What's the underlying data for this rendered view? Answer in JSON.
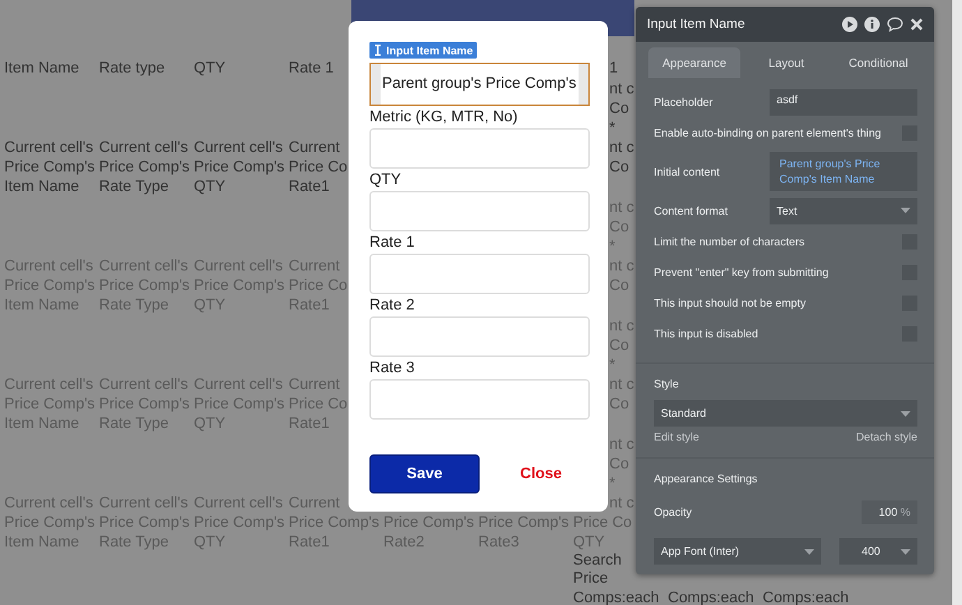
{
  "background": {
    "header": {
      "cells": [
        [
          "Item Name"
        ],
        [
          "Rate type"
        ],
        [
          "QTY"
        ],
        [
          "Rate 1"
        ],
        null,
        null,
        [
          "1"
        ]
      ]
    },
    "rows": [
      {
        "dim": false,
        "cells": [
          [
            "Current cell's",
            "Price Comp's",
            "Item Name"
          ],
          [
            "Current cell's",
            "Price Comp's",
            "Rate Type"
          ],
          [
            "Current cell's",
            "Price Comp's",
            "QTY"
          ],
          [
            "Current",
            "Price Co",
            "Rate1"
          ],
          null,
          null,
          [
            "nt c",
            "Co",
            "*",
            "nt c",
            "Co",
            null
          ]
        ]
      },
      {
        "dim": true,
        "cells": [
          [
            "Current cell's",
            "Price Comp's",
            "Item Name"
          ],
          [
            "Current cell's",
            "Price Comp's",
            "Rate Type"
          ],
          [
            "Current cell's",
            "Price Comp's",
            "QTY"
          ],
          [
            "Current",
            "Price Co",
            "Rate1"
          ],
          null,
          null,
          [
            "nt c",
            "Co",
            "*",
            "nt c",
            "Co",
            null
          ]
        ]
      },
      {
        "dim": true,
        "cells": [
          [
            "Current cell's",
            "Price Comp's",
            "Item Name"
          ],
          [
            "Current cell's",
            "Price Comp's",
            "Rate Type"
          ],
          [
            "Current cell's",
            "Price Comp's",
            "QTY"
          ],
          [
            "Current",
            "Price Co",
            "Rate1"
          ],
          null,
          null,
          [
            "nt c",
            "Co",
            "*",
            "nt c",
            "Co",
            null
          ]
        ]
      },
      {
        "dim": true,
        "cells": [
          [
            "Current cell's",
            "Price Comp's",
            "Item Name"
          ],
          [
            "Current cell's",
            "Price Comp's",
            "Rate Type"
          ],
          [
            "Current cell's",
            "Price Comp's",
            "QTY"
          ],
          [
            "Current",
            "Price Comp's",
            "Rate1"
          ],
          [
            null,
            "Price Comp's",
            "Rate2"
          ],
          [
            null,
            "Price Comp's",
            "Rate3"
          ],
          [
            "nt c",
            "Co",
            "*",
            "nt c",
            "Price Co",
            "QTY"
          ]
        ]
      },
      {
        "dim": false,
        "cells": [
          null,
          null,
          null,
          null,
          null,
          null,
          [
            "Search",
            "Price",
            "Comps:each"
          ],
          [
            null,
            "Comps:each"
          ],
          [
            null,
            "Comps:each"
          ]
        ]
      }
    ]
  },
  "modal": {
    "fields": [
      {
        "tag": "Input Item Name",
        "value": "Parent group's Price Comp's",
        "selected": true
      },
      {
        "label": "Metric (KG, MTR, No)",
        "selected": false
      },
      {
        "label": "QTY",
        "selected": false
      },
      {
        "label": "Rate 1",
        "selected": false
      },
      {
        "label": "Rate 2",
        "selected": false
      },
      {
        "label": "Rate 3",
        "selected": false
      }
    ],
    "save": "Save",
    "close": "Close"
  },
  "panel": {
    "title": "Input Item Name",
    "tabs": [
      {
        "label": "Appearance",
        "selected": true
      },
      {
        "label": "Layout",
        "selected": false
      },
      {
        "label": "Conditional",
        "selected": false
      }
    ],
    "rows": [
      {
        "kind": "field",
        "label": "Placeholder",
        "value": "asdf"
      },
      {
        "kind": "checkbox",
        "label": "Enable auto-binding on parent element's thing",
        "checked": false
      },
      {
        "kind": "expression",
        "label": "Initial content",
        "value": "Parent group's Price Comp's Item Name"
      },
      {
        "kind": "dropdown",
        "label": "Content format",
        "value": "Text"
      },
      {
        "kind": "checkbox",
        "label": "Limit the number of characters",
        "checked": false
      },
      {
        "kind": "checkbox",
        "label": "Prevent \"enter\" key from submitting",
        "checked": false
      },
      {
        "kind": "checkbox",
        "label": "This input should not be empty",
        "checked": false
      },
      {
        "kind": "checkbox",
        "label": "This input is disabled",
        "checked": false
      }
    ],
    "style": {
      "heading": "Style",
      "value": "Standard",
      "edit_link": "Edit style",
      "detach_link": "Detach style"
    },
    "appearance": {
      "heading": "Appearance Settings",
      "opacity_label": "Opacity",
      "opacity_value": "100",
      "opacity_unit": "%",
      "font": "App Font (Inter)",
      "weight": "400"
    }
  }
}
